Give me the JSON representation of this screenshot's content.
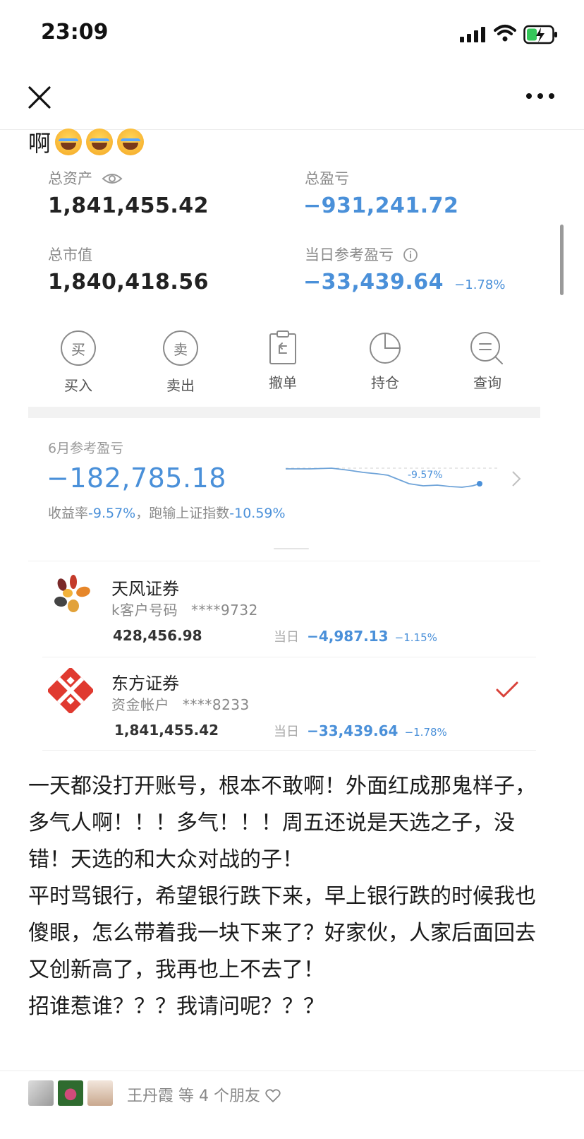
{
  "status_bar": {
    "time": "23:09"
  },
  "post": {
    "top_text": "啊",
    "body": [
      "一天都没打开账号，根本不敢啊！外面红成那鬼样子，多气人啊！！！多气！！！周五还说是天选之子，没错！天选的和大众对战的子！",
      "平时骂银行，希望银行跌下来，早上银行跌的时候我也傻眼，怎么带着我一块下来了？好家伙，人家后面回去又创新高了，我再也上不去了！",
      "招谁惹谁？？？我请问呢？？？"
    ]
  },
  "summary": {
    "total_assets_label": "总资产",
    "total_assets_value": "1,841,455.42",
    "total_pnl_label": "总盈亏",
    "total_pnl_value": "−931,241.72",
    "market_value_label": "总市值",
    "market_value_value": "1,840,418.56",
    "daily_pnl_label": "当日参考盈亏",
    "daily_pnl_value": "−33,439.64",
    "daily_pnl_pct": "−1.78%"
  },
  "actions": [
    {
      "glyph": "买",
      "label": "买入",
      "icon": "buy-icon"
    },
    {
      "glyph": "卖",
      "label": "卖出",
      "icon": "sell-icon"
    },
    {
      "glyph": "",
      "label": "撤单",
      "icon": "cancel-order-icon"
    },
    {
      "glyph": "",
      "label": "持仓",
      "icon": "pie-chart-icon"
    },
    {
      "glyph": "",
      "label": "查询",
      "icon": "search-list-icon"
    }
  ],
  "monthly": {
    "label": "6月参考盈亏",
    "value": "−182,785.18",
    "rate_prefix": "收益率",
    "rate_value": "-9.57%",
    "rate_mid": "，跑输上证指数",
    "rate_index": "-10.59%",
    "chart_end_label": "-9.57%"
  },
  "accounts": [
    {
      "name": "天风证券",
      "sub_label": "k客户号码",
      "sub_number": "****9732",
      "amount": "428,456.98",
      "day_label": "当日",
      "day_value": "−4,987.13",
      "day_pct": "−1.15%",
      "selected": false,
      "logo": "tianfeng-logo"
    },
    {
      "name": "东方证券",
      "sub_label": "资金帐户",
      "sub_number": "****8233",
      "amount": "1,841,455.42",
      "day_label": "当日",
      "day_value": "−33,439.64",
      "day_pct": "−1.78%",
      "selected": true,
      "logo": "dongfang-logo"
    }
  ],
  "likes": {
    "text": "王丹霞 等 4 个朋友"
  },
  "colors": {
    "accent_blue": "#4a90d9",
    "check_red": "#d9423a"
  }
}
